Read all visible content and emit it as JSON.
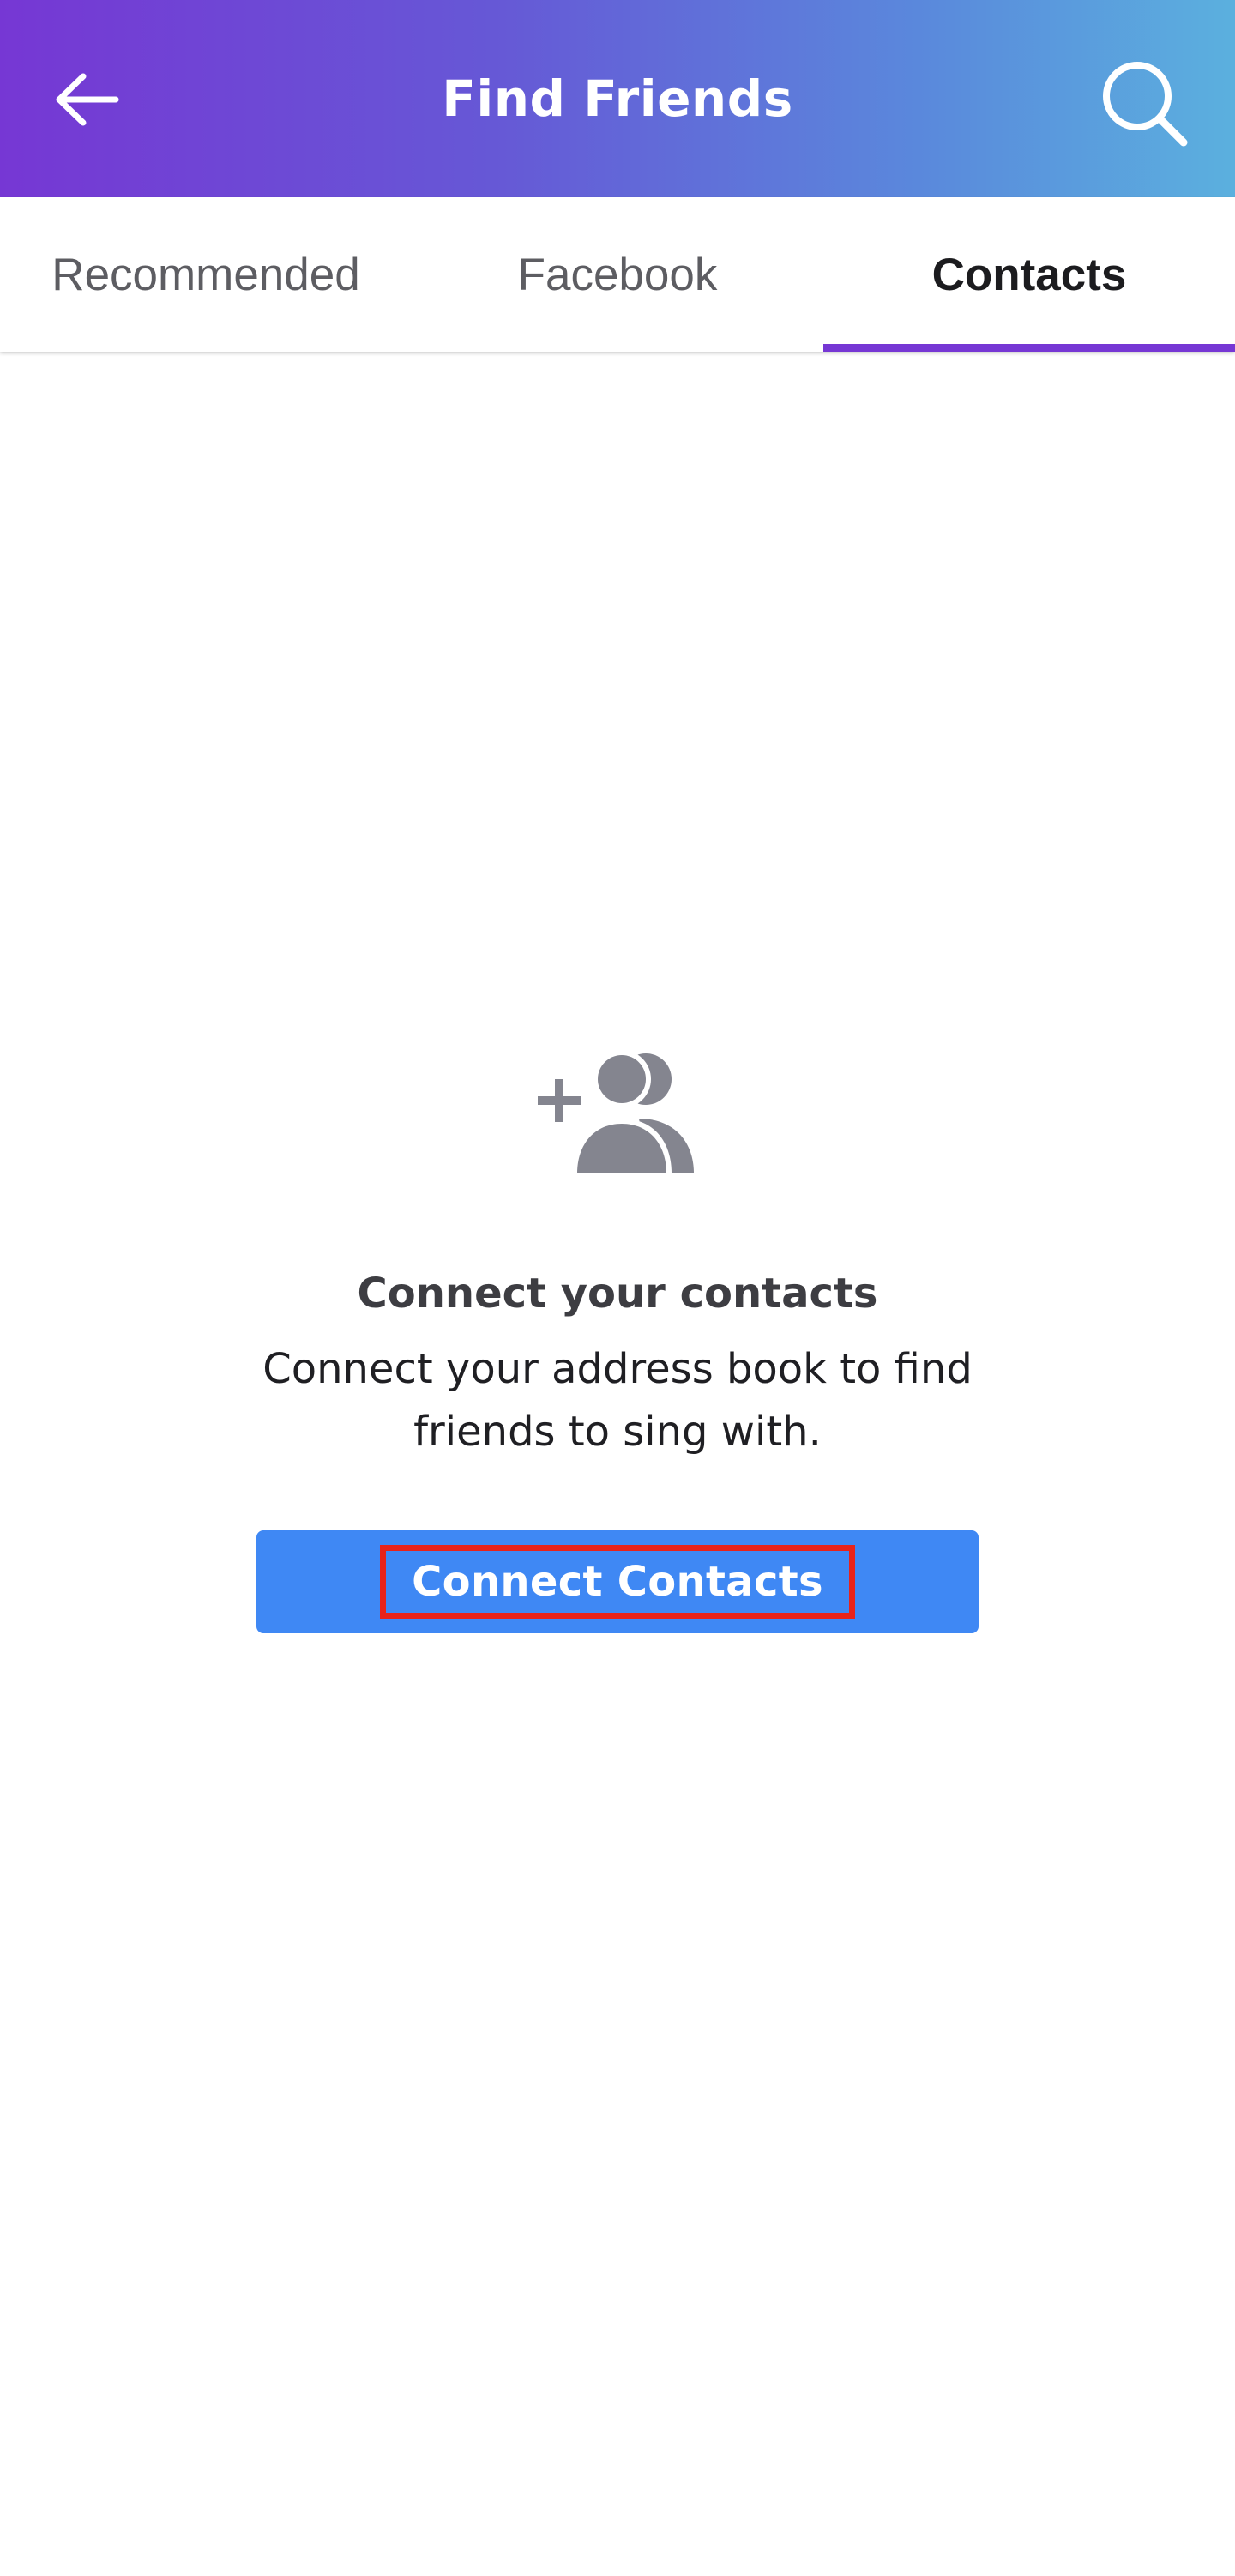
{
  "header": {
    "title": "Find Friends",
    "back_icon": "arrow-left-icon",
    "search_icon": "search-icon",
    "gradient_start": "#7637d4",
    "gradient_end": "#5bb0de"
  },
  "tabs": [
    {
      "label": "Recommended",
      "active": false
    },
    {
      "label": "Facebook",
      "active": false
    },
    {
      "label": "Contacts",
      "active": true
    }
  ],
  "tab_indicator_color": "#7637d4",
  "empty_state": {
    "icon": "add-contacts-icon",
    "title": "Connect your contacts",
    "description": "Connect your address book to find friends to sing with.",
    "button_label": "Connect Contacts",
    "button_color": "#3f88f4"
  }
}
